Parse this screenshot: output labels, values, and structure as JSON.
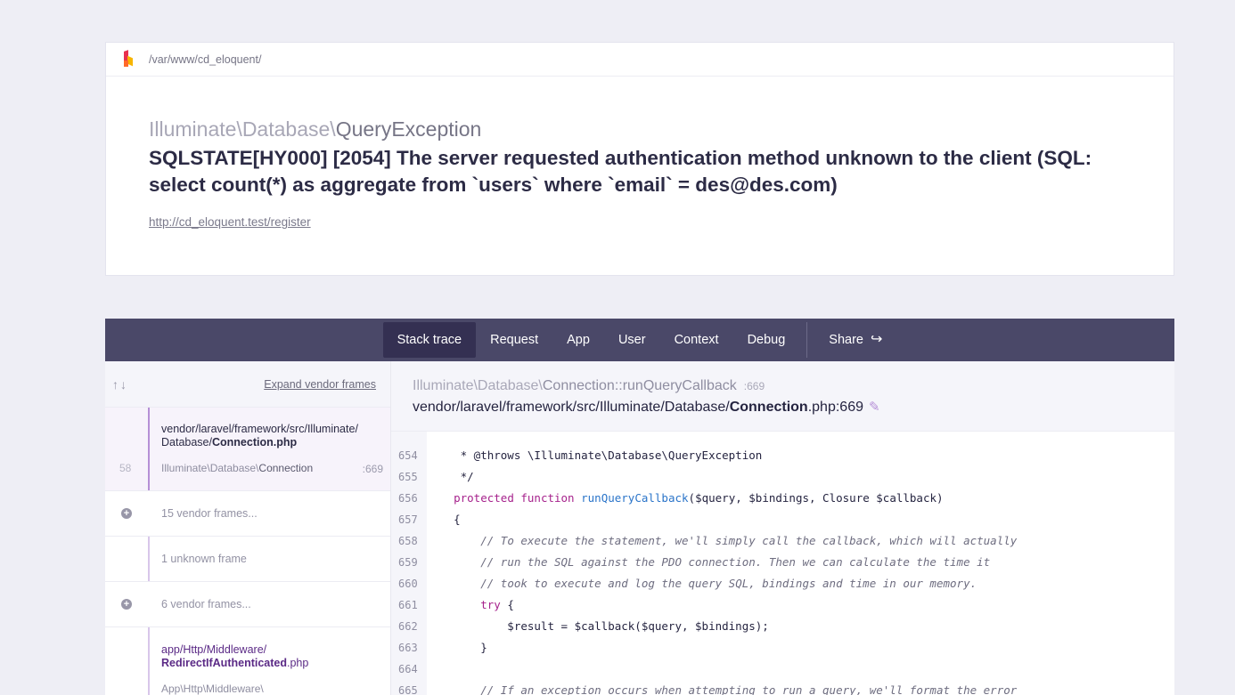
{
  "header": {
    "path": "/var/www/cd_eloquent/",
    "exception_namespace": "Illuminate\\Database\\",
    "exception_short": "QueryException",
    "message": "SQLSTATE[HY000] [2054] The server requested authentication method unknown to the client (SQL: select count(*) as aggregate from `users` where `email` = des@des.com)",
    "url": "http://cd_eloquent.test/register"
  },
  "tabs": {
    "stack_trace": "Stack trace",
    "request": "Request",
    "app": "App",
    "user": "User",
    "context": "Context",
    "debug": "Debug",
    "share": "Share"
  },
  "sidebar": {
    "arrows": "↑↓",
    "expand_label": "Expand vendor frames",
    "frames": [
      {
        "number": "58",
        "file_dir": "vendor/laravel/framework/src/Illuminate/",
        "file_sub": "Database/",
        "file_name": "Connection.php",
        "class_ns": "Illuminate\\Database\\",
        "class_name": "Connection",
        "line": ":669"
      },
      {
        "label": "15 vendor frames..."
      },
      {
        "label": "1 unknown frame"
      },
      {
        "label": "6 vendor frames..."
      },
      {
        "file_dir": "app/Http/Middleware/",
        "file_name": "RedirectIfAuthenticated",
        "file_ext": ".php",
        "class_ns": "App\\Http\\Middleware\\"
      }
    ]
  },
  "code_header": {
    "class_ns": "Illuminate\\Database\\",
    "class_name": "Connection",
    "method": "::runQueryCallback",
    "line": ":669",
    "file_path": "vendor/laravel/framework/src/Illuminate/Database/",
    "file_name": "Connection",
    "file_ext": ".php:669"
  },
  "code": {
    "line_numbers": [
      "654",
      "655",
      "656",
      "657",
      "658",
      "659",
      "660",
      "661",
      "662",
      "663",
      "664",
      "665"
    ],
    "lines": [
      "     * @throws \\Illuminate\\Database\\QueryException",
      "     */",
      "    protected function runQueryCallback($query, $bindings, Closure $callback)",
      "    {",
      "        // To execute the statement, we'll simply call the callback, which will actually",
      "        // run the SQL against the PDO connection. Then we can calculate the time it",
      "        // took to execute and log the query SQL, bindings and time in our memory.",
      "        try {",
      "            $result = $callback($query, $bindings);",
      "        }",
      "",
      "        // If an exception occurs when attempting to run a query, we'll format the error"
    ]
  }
}
